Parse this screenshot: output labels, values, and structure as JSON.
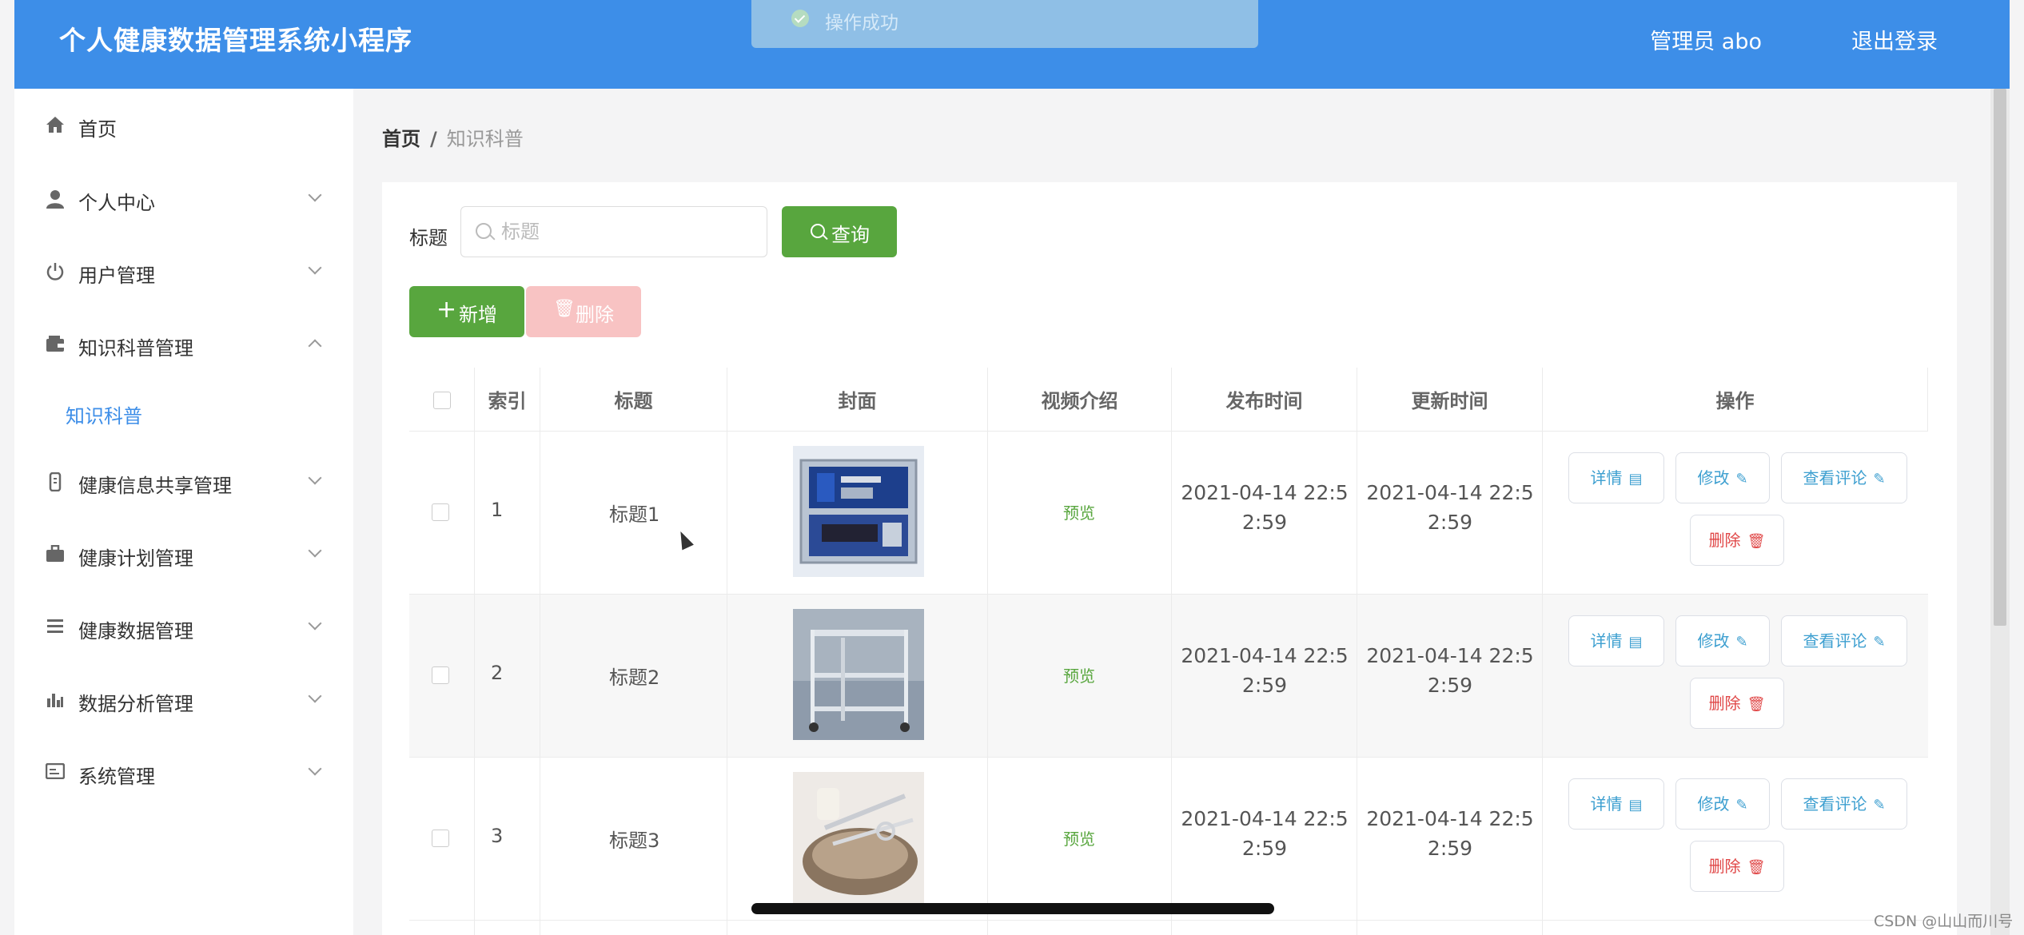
{
  "app": {
    "title": "个人健康数据管理系统小程序"
  },
  "toast": {
    "text": "操作成功"
  },
  "header": {
    "user": "管理员 abo",
    "logout": "退出登录"
  },
  "sidebar": {
    "items": [
      {
        "label": "首页",
        "icon": "home-icon"
      },
      {
        "label": "个人中心",
        "icon": "user-icon"
      },
      {
        "label": "用户管理",
        "icon": "power-icon"
      },
      {
        "label": "知识科普管理",
        "icon": "wallet-icon"
      },
      {
        "label": "健康信息共享管理",
        "icon": "bottle-icon"
      },
      {
        "label": "健康计划管理",
        "icon": "briefcase-icon"
      },
      {
        "label": "健康数据管理",
        "icon": "list-icon"
      },
      {
        "label": "数据分析管理",
        "icon": "bar-chart-icon"
      },
      {
        "label": "系统管理",
        "icon": "system-icon"
      }
    ],
    "subitem": "知识科普"
  },
  "breadcrumb": {
    "home": "首页",
    "separator": "/",
    "current": "知识科普"
  },
  "search": {
    "label": "标题",
    "placeholder": "标题",
    "button": "查询"
  },
  "actions": {
    "add": "新增",
    "delete": "删除"
  },
  "table": {
    "headers": [
      "索引",
      "标题",
      "封面",
      "视频介绍",
      "发布时间",
      "更新时间",
      "操作"
    ],
    "rows": [
      {
        "index": "1",
        "title": "标题1",
        "video": "预览",
        "publish_line1": "2021-04-14 22:5",
        "publish_line2": "2:59",
        "update_line1": "2021-04-14 22:5",
        "update_line2": "2:59"
      },
      {
        "index": "2",
        "title": "标题2",
        "video": "预览",
        "publish_line1": "2021-04-14 22:5",
        "publish_line2": "2:59",
        "update_line1": "2021-04-14 22:5",
        "update_line2": "2:59"
      },
      {
        "index": "3",
        "title": "标题3",
        "video": "预览",
        "publish_line1": "2021-04-14 22:5",
        "publish_line2": "2:59",
        "update_line1": "2021-04-14 22:5",
        "update_line2": "2:59"
      }
    ],
    "row_actions": {
      "detail": "详情",
      "edit": "修改",
      "comments": "查看评论",
      "delete": "删除"
    }
  },
  "watermark": "CSDN @山山而川号",
  "colors": {
    "header": "#3d8ee8",
    "success": "#58a63e",
    "danger": "#e04848",
    "link": "#3d9fd0"
  }
}
